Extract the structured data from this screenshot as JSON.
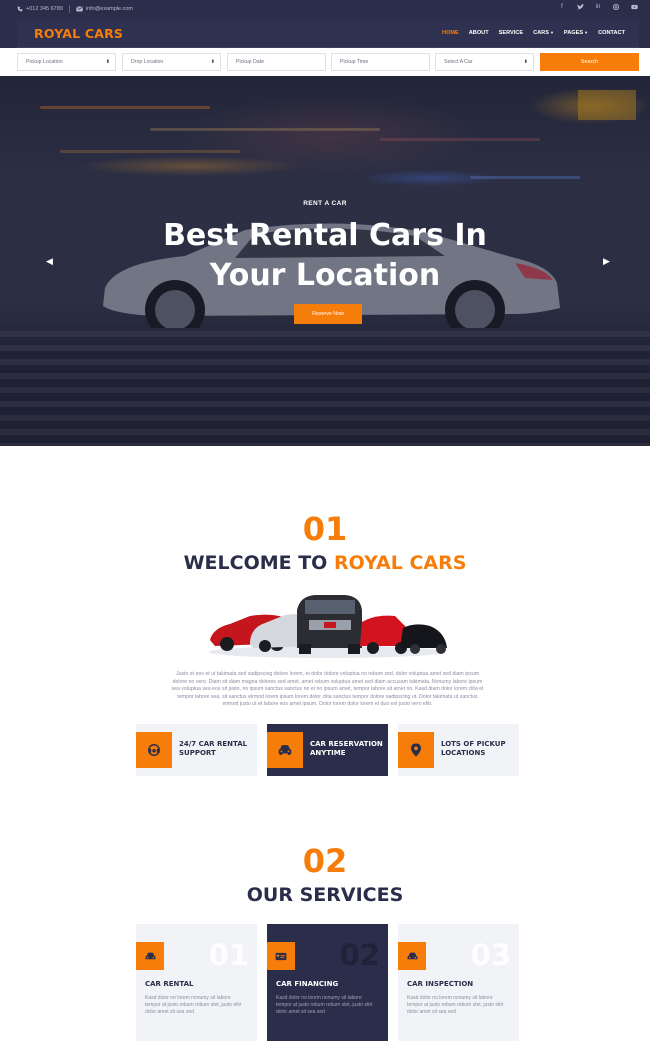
{
  "colors": {
    "accent": "#f77d0a",
    "dark": "#2b2e4a",
    "light_panel": "#f2f3f7"
  },
  "topbar": {
    "phone": "+012 345 6789",
    "email": "info@example.com",
    "social_icons": [
      "facebook-icon",
      "twitter-icon",
      "linkedin-icon",
      "instagram-icon",
      "youtube-icon"
    ]
  },
  "navbar": {
    "brand": "ROYAL CARS",
    "items": [
      {
        "label": "HOME",
        "active": true
      },
      {
        "label": "ABOUT"
      },
      {
        "label": "SERVICE"
      },
      {
        "label": "CARS",
        "dropdown": true
      },
      {
        "label": "PAGES",
        "dropdown": true
      },
      {
        "label": "CONTACT"
      }
    ]
  },
  "booking": {
    "pickup_location": "Pickup Location",
    "drop_location": "Drop Location",
    "pickup_date": "Pickup Date",
    "pickup_time": "Pickup Time",
    "select_car": "Select A Car",
    "search": "Search"
  },
  "hero": {
    "subtitle": "RENT A CAR",
    "title": "Best Rental Cars In Your Location",
    "button": "Reserve Now"
  },
  "welcome": {
    "number": "01",
    "title_prefix": "WELCOME TO",
    "title_highlight": "ROYAL CARS",
    "paragraph": "Justo et eos et ut takimata sed sadipscing dolore lorem, et dolor dolore voluptua no rebum sed, dolor voluptua amet sed diam ipsum dolore no vero. Diam sit diam magna dolores sed amet, amet rebum voluptua amet sed diam accusam takimata. Nonumy labore ipsum sea voluptua sea eos sit justo, no ipsum sanctus sanctus no et no ipsum amet, tempor labore sit amet no. Kasd diam dolor lorem clita et tempor labore sea, sit sanctus eirmod lorem ipsum lorem dolor clita sanctus tempor dolore sadipscing ut. Dolor takimata ut sanctus eirmod justo ut et labore eos amet ipsum. Dolor lorem dolor lorem et duo est justo vero elitr.",
    "features": [
      {
        "icon": "headset-icon",
        "label": "24/7 CAR RENTAL SUPPORT"
      },
      {
        "icon": "car-icon",
        "label": "CAR RESERVATION ANYTIME"
      },
      {
        "icon": "map-marker-icon",
        "label": "LOTS OF PICKUP LOCATIONS"
      }
    ]
  },
  "services": {
    "number": "02",
    "title": "OUR SERVICES",
    "items": [
      {
        "num": "01",
        "icon": "car-icon",
        "title": "CAR RENTAL",
        "desc": "Kasd dolor no lorem nonumy sit labore tempor at justo rebum rebum stet, justo elitr dolor amet sit sea sed"
      },
      {
        "num": "02",
        "icon": "money-card-icon",
        "title": "CAR FINANCING",
        "desc": "Kasd dolor no lorem nonumy sit labore tempor at justo rebum rebum stet, justo elitr dolor amet sit sea sed"
      },
      {
        "num": "03",
        "icon": "car-icon",
        "title": "CAR INSPECTION",
        "desc": "Kasd dolor no lorem nonumy sit labore tempor at justo rebum rebum stet, justo elitr dolor amet sit sea sed"
      }
    ]
  }
}
